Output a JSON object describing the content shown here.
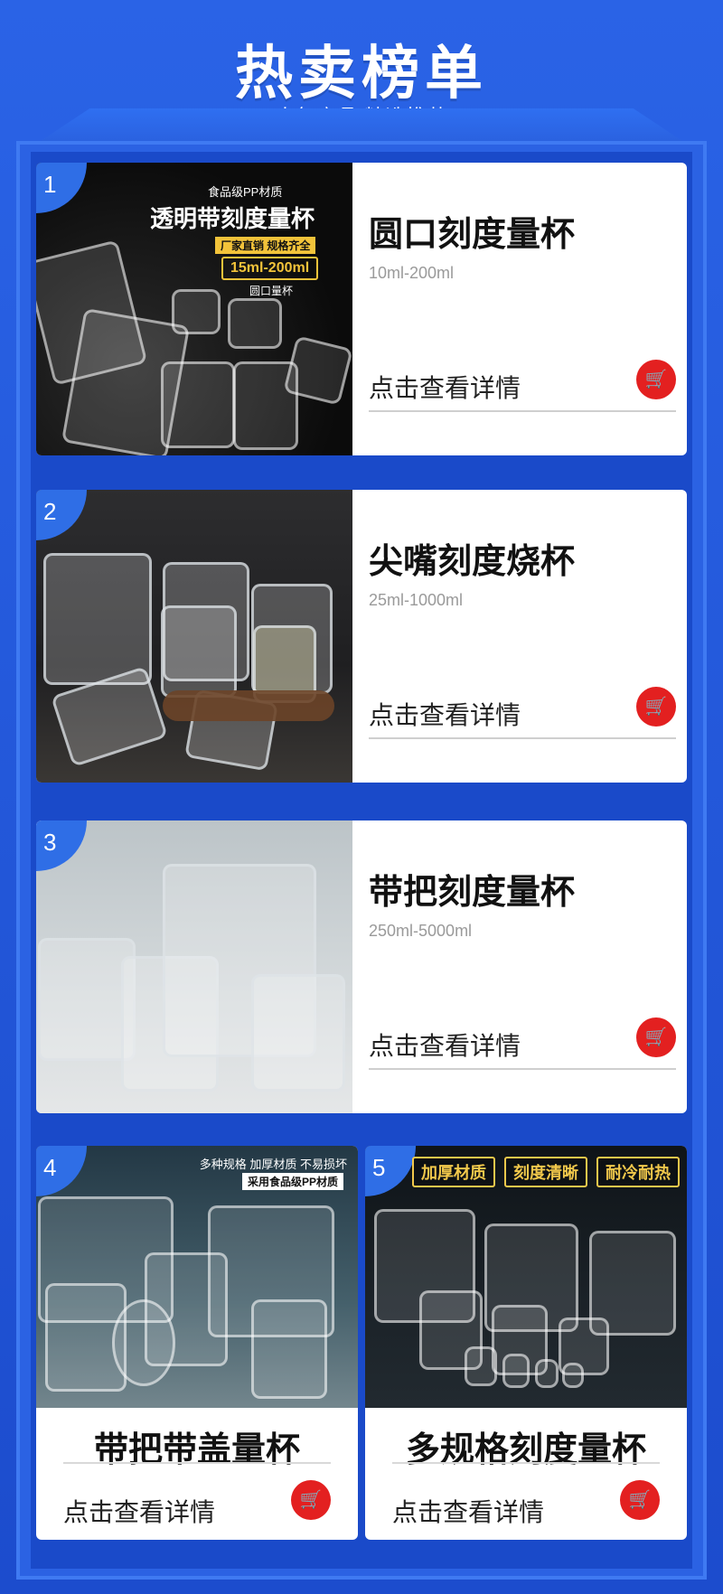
{
  "header": {
    "title": "热卖榜单",
    "subtitle": "人气商品 精选推荐"
  },
  "products": [
    {
      "rank": "1",
      "name": "圆口刻度量杯",
      "spec": "10ml-200ml",
      "cta": "点击查看详情",
      "image_text": {
        "line1": "食品级PP材质",
        "line2": "透明带刻度量杯",
        "line3": "厂家直销  规格齐全",
        "line4": "15ml-200ml",
        "line5": "圆口量杯"
      }
    },
    {
      "rank": "2",
      "name": "尖嘴刻度烧杯",
      "spec": "25ml-1000ml",
      "cta": "点击查看详情"
    },
    {
      "rank": "3",
      "name": "带把刻度量杯",
      "spec": "250ml-5000ml",
      "cta": "点击查看详情"
    },
    {
      "rank": "4",
      "name": "带把带盖量杯",
      "cta": "点击查看详情",
      "image_text": {
        "line1": "多种规格 加厚材质 不易损坏",
        "line2": "采用食品级PP材质"
      }
    },
    {
      "rank": "5",
      "name": "多规格刻度量杯",
      "cta": "点击查看详情",
      "image_chips": [
        "加厚材质",
        "刻度清晰",
        "耐冷耐热"
      ]
    }
  ],
  "icons": {
    "cart": "shopping-cart-icon"
  },
  "colors": {
    "background": "#1c4ccd",
    "badge": "#2f6ee6",
    "cart": "#e32020"
  }
}
